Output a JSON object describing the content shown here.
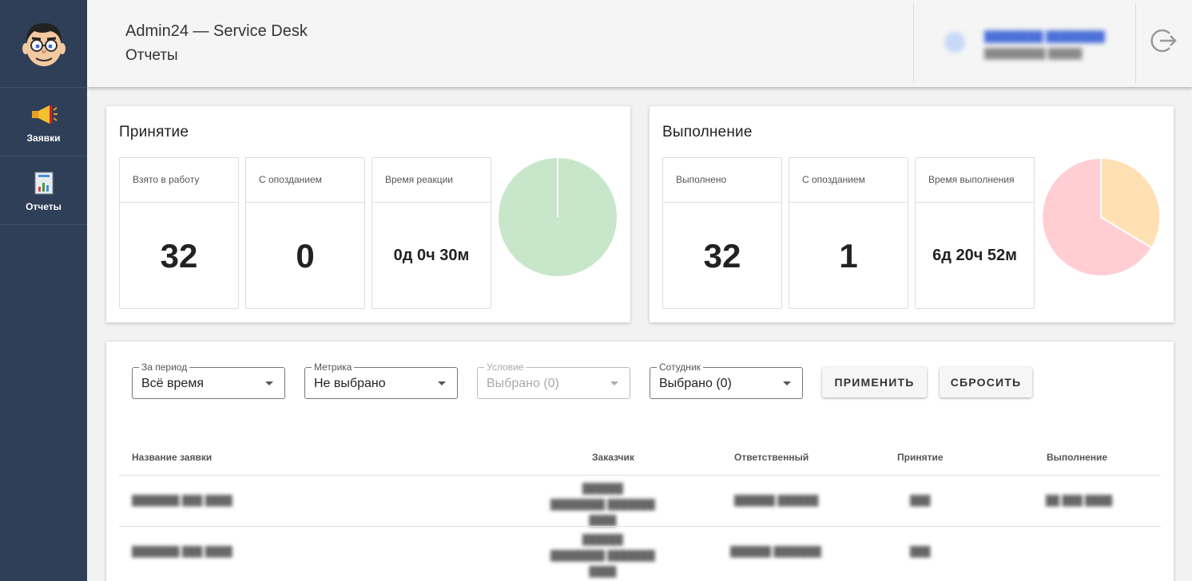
{
  "sidebar": {
    "items": [
      {
        "label": "Заявки",
        "icon": "megaphone-icon"
      },
      {
        "label": "Отчеты",
        "icon": "report-chart-icon"
      }
    ]
  },
  "header": {
    "app_title": "Admin24 — Service Desk",
    "page_title": "Отчеты"
  },
  "acceptance": {
    "title": "Принятие",
    "stats": [
      {
        "label": "Взято в работу",
        "value": "32"
      },
      {
        "label": "С опозданием",
        "value": "0"
      },
      {
        "label": "Время реакции",
        "value": "0д 0ч 30м"
      }
    ],
    "pie": {
      "on_time": 32,
      "late": 0,
      "color_on_time": "#c8e6c9",
      "color_late": "#ffe0b2"
    }
  },
  "completion": {
    "title": "Выполнение",
    "stats": [
      {
        "label": "Выполнено",
        "value": "32"
      },
      {
        "label": "С опозданием",
        "value": "1"
      },
      {
        "label": "Время выполнения",
        "value": "6д 20ч 52м"
      }
    ],
    "pie": {
      "late_fraction": 0.33,
      "on_time_fraction": 0.67,
      "color_on_time": "#ffcdd2",
      "color_late": "#ffe0b2"
    }
  },
  "filters": {
    "period": {
      "label": "За период",
      "value": "Всё время"
    },
    "metric": {
      "label": "Метрика",
      "value": "Не выбрано"
    },
    "condition": {
      "label": "Условие",
      "value": "Выбрано (0)"
    },
    "employee": {
      "label": "Сотудник",
      "value": "Выбрано (0)"
    },
    "apply_label": "ПРИМЕНИТЬ",
    "reset_label": "СБРОСИТЬ"
  },
  "table": {
    "headers": [
      "Название заявки",
      "Заказчик",
      "Ответственный",
      "Принятие",
      "Выполнение"
    ]
  },
  "colors": {
    "sidebar": "#2f3f58",
    "header": "#f5f5f5"
  }
}
